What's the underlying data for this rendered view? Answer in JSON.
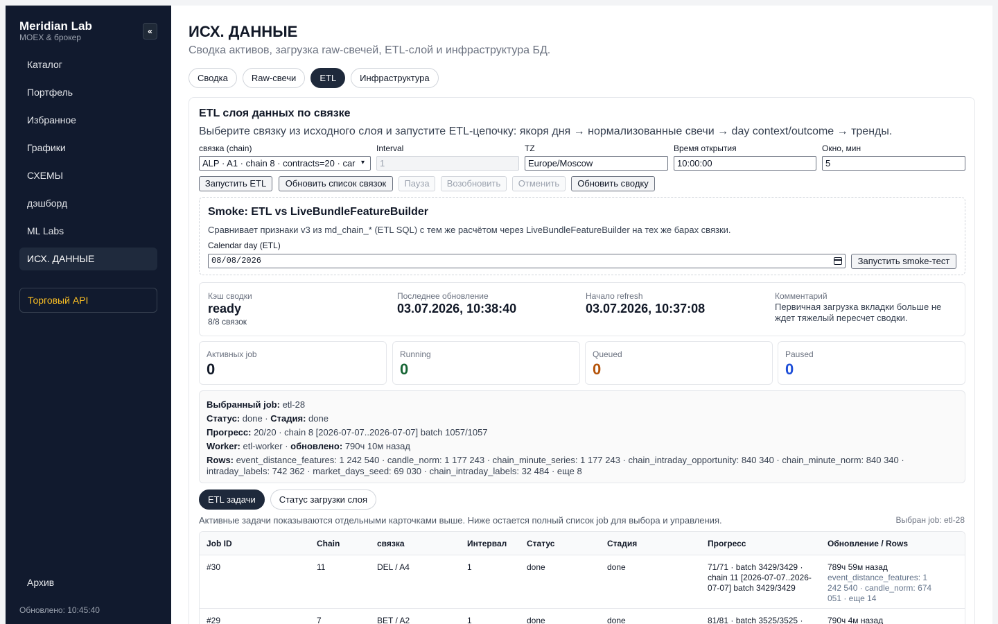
{
  "sidebar": {
    "brand_title": "Meridian Lab",
    "brand_sub": "MOEX & брокер",
    "collapse_label": "«",
    "items": [
      {
        "label": "Каталог"
      },
      {
        "label": "Портфель"
      },
      {
        "label": "Избранное"
      },
      {
        "label": "Графики"
      },
      {
        "label": "СХЕМЫ"
      },
      {
        "label": "дэшборд"
      },
      {
        "label": "ML Labs"
      },
      {
        "label": "ИСХ. ДАННЫЕ"
      }
    ],
    "active_index": 7,
    "api_label": "Торговый API",
    "archive_label": "Архив",
    "updated": "Обновлено: 10:45:40"
  },
  "header": {
    "title": "ИСХ. ДАННЫЕ",
    "subtitle": "Сводка активов, загрузка raw-свечей, ETL-слой и инфраструктура БД."
  },
  "tabs": [
    {
      "label": "Сводка"
    },
    {
      "label": "Raw-свечи"
    },
    {
      "label": "ETL"
    },
    {
      "label": "Инфраструктура"
    }
  ],
  "etl": {
    "title": "ETL слоя данных по связке",
    "description": "Выберите связку из исходного слоя и запустите ETL-цепочку: якоря дня → нормализованные свечи → day context/outcome → тренды.",
    "fields": {
      "chain_label": "связка (chain)",
      "chain_value": "ALP · A1 · chain 8 · contracts=20 · car",
      "interval_label": "Interval",
      "interval_value": "1",
      "tz_label": "TZ",
      "tz_value": "Europe/Moscow",
      "open_label": "Время открытия",
      "open_value": "10:00:00",
      "window_label": "Окно, мин",
      "window_value": "5"
    },
    "buttons": {
      "run": "Запустить ETL",
      "refresh_list": "Обновить список связок",
      "pause": "Пауза",
      "resume": "Возобновить",
      "cancel": "Отменить",
      "refresh_summary": "Обновить сводку"
    }
  },
  "smoke": {
    "title": "Smoke: ETL vs LiveBundleFeatureBuilder",
    "description": "Сравнивает признаки v3 из md_chain_* (ETL SQL) с тем же расчётом через LiveBundleFeatureBuilder на тех же барах связки.",
    "date_label": "Calendar day (ETL)",
    "date_value": "08/08/2026",
    "run_label": "Запустить smoke-тест"
  },
  "cache": {
    "status_label": "Кэш сводки",
    "status_value": "ready",
    "status_sub": "8/8 связок",
    "last_update_label": "Последнее обновление",
    "last_update_value": "03.07.2026, 10:38:40",
    "refresh_start_label": "Начало refresh",
    "refresh_start_value": "03.07.2026, 10:37:08",
    "comment_label": "Комментарий",
    "comment_value": "Первичная загрузка вкладки больше не ждет тяжелый пересчет сводки."
  },
  "stats": [
    {
      "label": "Активных job",
      "value": "0",
      "color": "#111827"
    },
    {
      "label": "Running",
      "value": "0",
      "color": "#166534"
    },
    {
      "label": "Queued",
      "value": "0",
      "color": "#b45309"
    },
    {
      "label": "Paused",
      "value": "0",
      "color": "#1d4ed8"
    }
  ],
  "job": {
    "selected_label": "Выбранный job:",
    "selected_value": "etl-28",
    "status_label": "Статус:",
    "status_value": "done",
    "stage_label": "Стадия:",
    "stage_value": "done",
    "progress_label": "Прогресс:",
    "progress_value": "20/20 · chain 8 [2026-07-07..2026-07-07] batch 1057/1057",
    "worker_label": "Worker:",
    "worker_value": "etl-worker",
    "updated_label": "обновлено:",
    "updated_value": "790ч 10м назад",
    "rows_label": "Rows:",
    "rows_value": "event_distance_features: 1 242 540 · candle_norm: 1 177 243 · chain_minute_series: 1 177 243 · chain_intraday_opportunity: 840 340 · chain_minute_norm: 840 340 · intraday_labels: 742 362 · market_days_seed: 69 030 · chain_intraday_labels: 32 484 · еще 8"
  },
  "subtabs": [
    {
      "label": "ETL задачи"
    },
    {
      "label": "Статус загрузки слоя"
    }
  ],
  "list_note": "Активные задачи показываются отдельными карточками выше. Ниже остается полный список job для выбора и управления.",
  "list_selected": "Выбран job: etl-28",
  "table": {
    "headers": [
      "Job ID",
      "Chain",
      "связка",
      "Интервал",
      "Статус",
      "Стадия",
      "Прогресс",
      "Обновление / Rows"
    ],
    "rows": [
      {
        "id": "#30",
        "chain": "11",
        "pair": "DEL / A4",
        "interval": "1",
        "status": "done",
        "stage": "done",
        "progress": "71/71 · batch 3429/3429 · chain 11 [2026-07-07..2026-07-07] batch 3429/3429",
        "updated": "789ч 59м назад",
        "rows": "event_distance_features: 1 242 540 · candle_norm: 674 051 · еще 14"
      },
      {
        "id": "#29",
        "chain": "7",
        "pair": "BET / A2",
        "interval": "1",
        "status": "done",
        "stage": "done",
        "progress": "81/81 · batch 3525/3525 ·",
        "updated": "790ч 4м назад",
        "rows": ""
      }
    ]
  }
}
